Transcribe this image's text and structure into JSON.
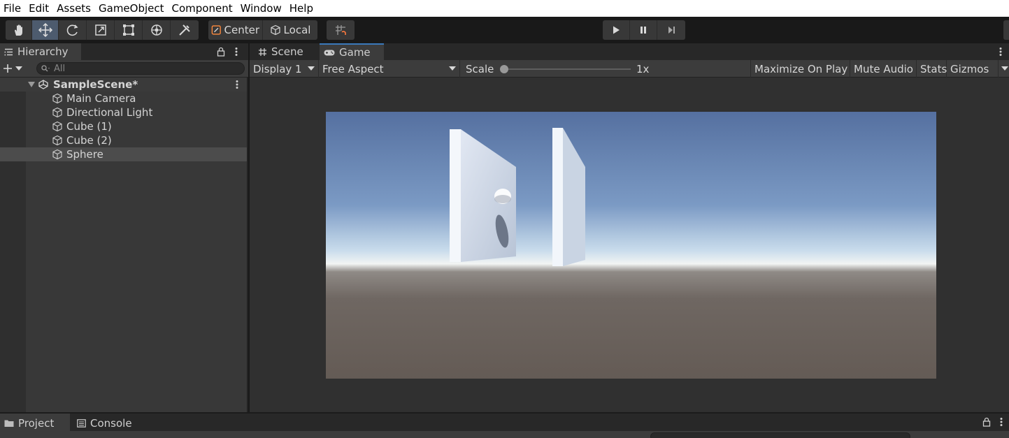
{
  "menu": [
    "File",
    "Edit",
    "Assets",
    "GameObject",
    "Component",
    "Window",
    "Help"
  ],
  "toolbar": {
    "tools": [
      "hand-tool-icon",
      "move-tool-icon",
      "rotate-tool-icon",
      "scale-tool-icon",
      "rect-tool-icon",
      "transform-tool-icon",
      "custom-tool-icon"
    ],
    "active_tool": "move-tool-icon",
    "pivot_label": "Center",
    "space_label": "Local",
    "accent": "#4d5b6e"
  },
  "hierarchy": {
    "tab_label": "Hierarchy",
    "search_placeholder": "All",
    "scene_name": "SampleScene*",
    "items": [
      {
        "label": "Main Camera"
      },
      {
        "label": "Directional Light"
      },
      {
        "label": "Cube (1)"
      },
      {
        "label": "Cube (2)"
      },
      {
        "label": "Sphere"
      }
    ],
    "selected": "Sphere"
  },
  "tabs": {
    "scene_label": "Scene",
    "game_label": "Game"
  },
  "game": {
    "display": "Display 1",
    "aspect": "Free Aspect",
    "scale_label": "Scale",
    "scale_value": "1x",
    "scale_fraction": 0.0,
    "maximize": "Maximize On Play",
    "mute": "Mute Audio",
    "stats": "Stats",
    "gizmos": "Gizmos"
  },
  "bottom": {
    "project_label": "Project",
    "console_label": "Console"
  }
}
